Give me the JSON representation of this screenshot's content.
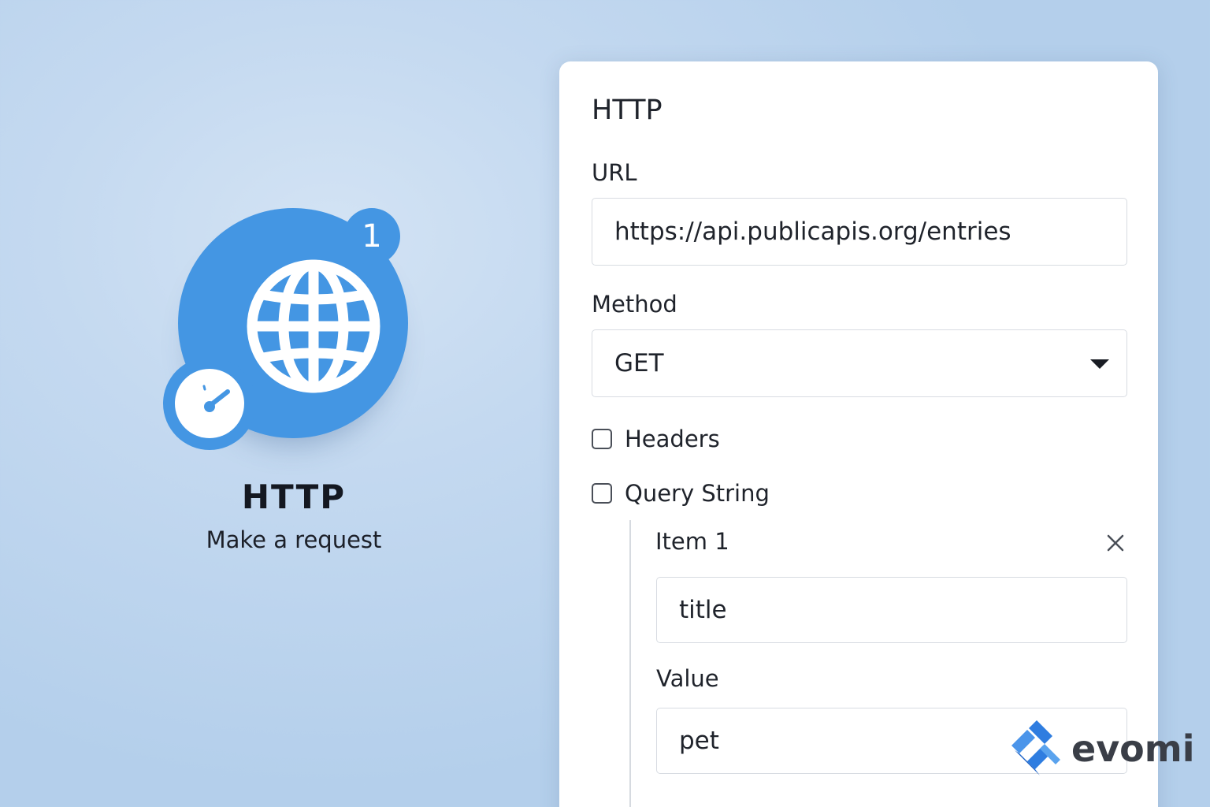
{
  "module": {
    "title": "HTTP",
    "subtitle": "Make a request",
    "badge_count": "1",
    "icon": "globe-icon",
    "schedule_icon": "clock-icon",
    "color": "#4496e3"
  },
  "panel": {
    "title": "HTTP",
    "url": {
      "label": "URL",
      "value": "https://api.publicapis.org/entries"
    },
    "method": {
      "label": "Method",
      "value": "GET"
    },
    "headers": {
      "label": "Headers",
      "checked": false
    },
    "query_string": {
      "label": "Query String",
      "checked": false,
      "items": [
        {
          "title": "Item 1",
          "name_value": "title",
          "value_label": "Value",
          "value": "pet"
        }
      ]
    }
  },
  "brand": {
    "name": "evomi",
    "color": "#2f7de0"
  }
}
